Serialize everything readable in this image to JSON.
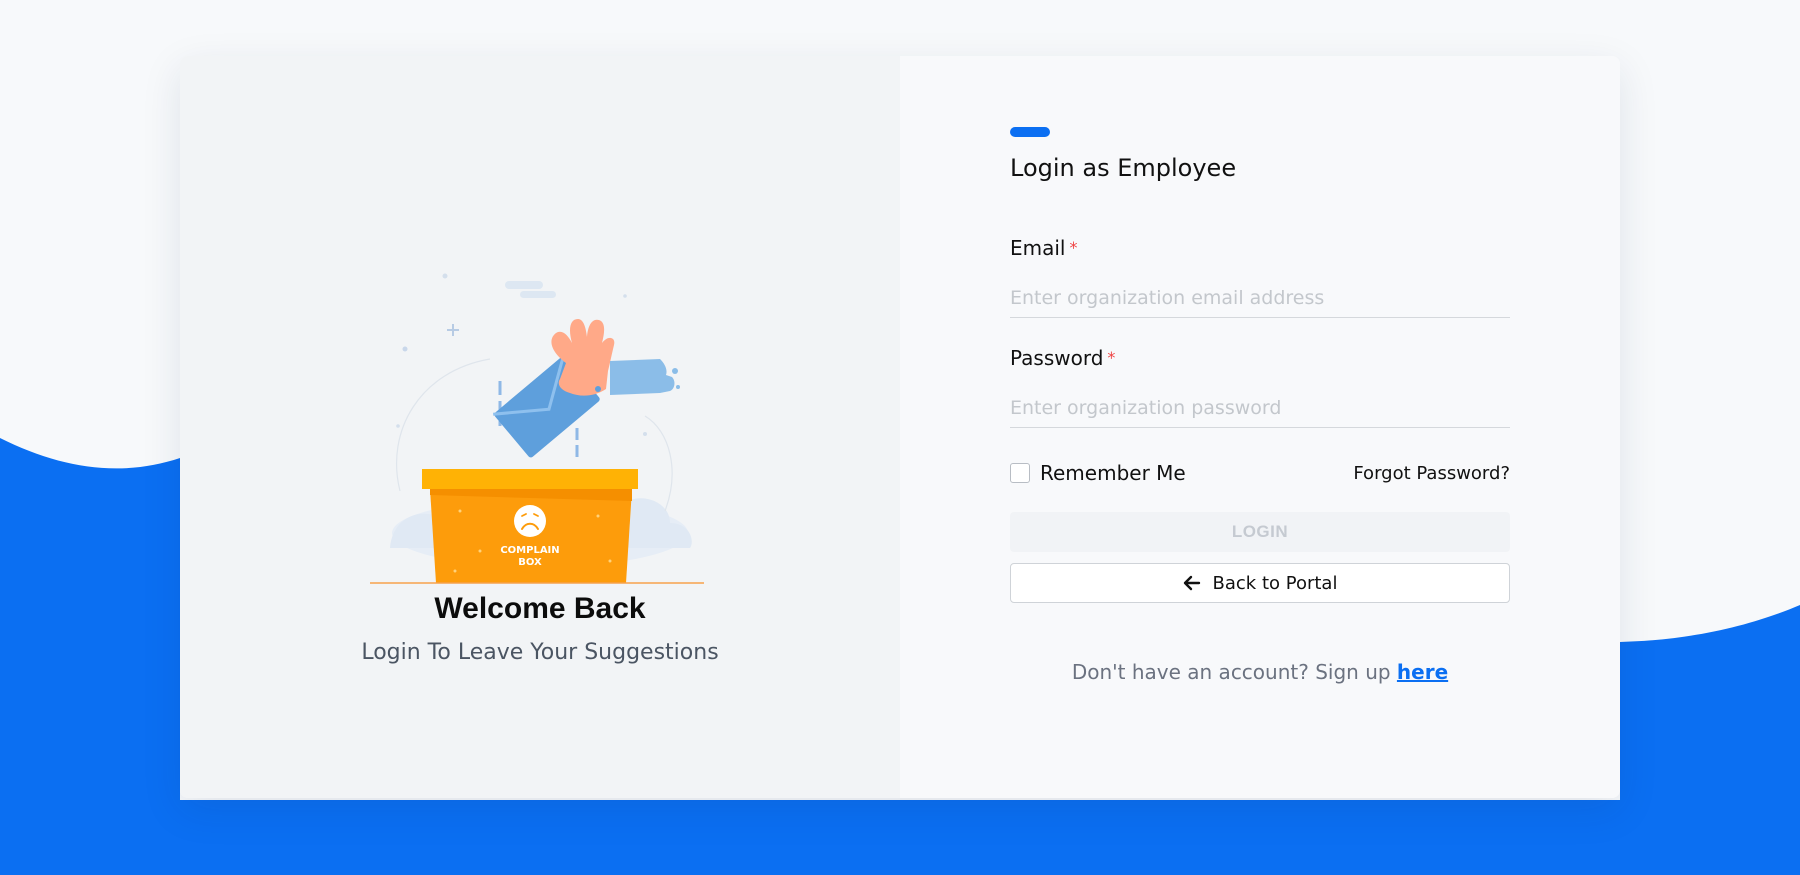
{
  "colors": {
    "accent": "#0b6ff2",
    "wave": "#0b6ff2",
    "box_orange": "#fd9c0b",
    "required": "#ef4444"
  },
  "illustration": {
    "icon": "complaint-box-illustration",
    "box_text_line1": "COMPLAIN",
    "box_text_line2": "BOX"
  },
  "left": {
    "welcome_title": "Welcome Back",
    "welcome_subtitle": "Login To Leave Your Suggestions"
  },
  "form": {
    "title": "Login as Employee",
    "email_label": "Email",
    "email_placeholder": "Enter organization email address",
    "email_value": "",
    "password_label": "Password",
    "password_placeholder": "Enter organization password",
    "password_value": "",
    "required_mark": "*",
    "remember_label": "Remember Me",
    "remember_checked": false,
    "forgot_label": "Forgot Password?",
    "login_label": "LOGIN",
    "back_label": "Back to Portal",
    "back_icon": "arrow-left-icon",
    "signup_prefix": "Don't have an account? Sign up ",
    "signup_link": "here"
  }
}
